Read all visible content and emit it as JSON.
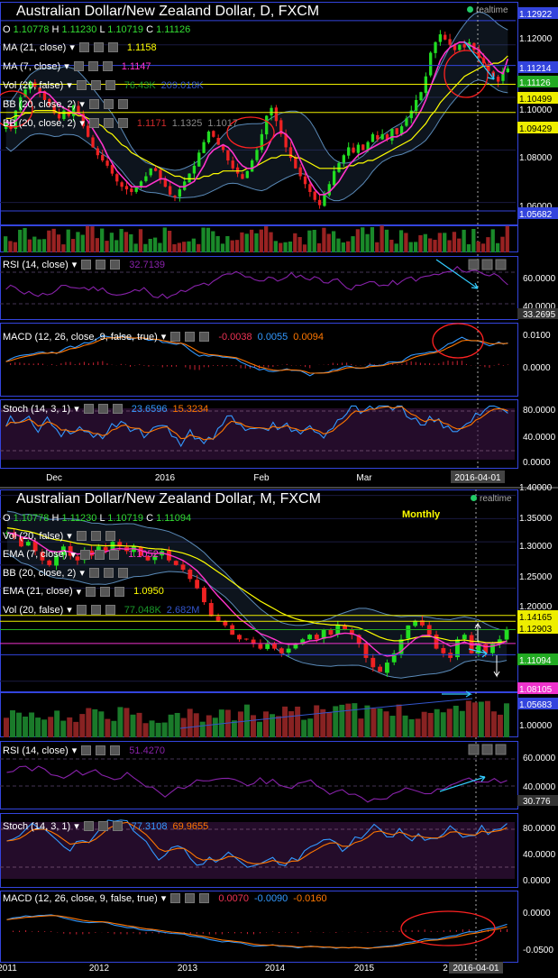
{
  "colors": {
    "background": "#000000",
    "grid": "#1a1a40",
    "frame": "#3344dd",
    "candle_up": "#22dd22",
    "candle_down": "#ee2222",
    "ma21": "#ffff00",
    "ma7": "#ff33cc",
    "bollinger": "#5a8ab8",
    "rsi": "#8822aa",
    "macd_line": "#3399ff",
    "signal_line": "#ff7700",
    "stoch_k": "#3399ff",
    "stoch_d": "#ff7700",
    "annotation": "#ff2222",
    "arrow": "#33ccff"
  },
  "daily": {
    "title": "Australian Dollar/New Zealand Dollar, D, FXCM",
    "realtime": "realtime",
    "ohlc": {
      "o_label": "O",
      "o": "1.10778",
      "h_label": "H",
      "h": "1.11230",
      "l_label": "L",
      "l": "1.10719",
      "c_label": "C",
      "c": "1.11126"
    },
    "indicators": [
      {
        "label": "MA (21, close)",
        "values": [
          "1.1158"
        ],
        "colors": [
          "#ffff00"
        ]
      },
      {
        "label": "MA (7, close)",
        "values": [
          "1.1147"
        ],
        "colors": [
          "#ff33cc"
        ]
      },
      {
        "label": "Vol (20, false)",
        "values": [
          "76.43K",
          "209.018K"
        ],
        "colors": [
          "#1a9a2a",
          "#3355cc"
        ]
      },
      {
        "label": "BB (20, close, 2)",
        "values": [],
        "colors": []
      },
      {
        "label": "BB (20, close, 2)",
        "values": [
          "1.1171",
          "1.1325",
          "1.1017"
        ],
        "colors": [
          "#cc2a2a",
          "#888888",
          "#888888"
        ]
      }
    ],
    "price_labels": [
      {
        "text": "1.12922",
        "bg": "#3344dd",
        "fg": "#ffffff"
      },
      {
        "text": "1.12000",
        "bg": "",
        "fg": "#ffffff"
      },
      {
        "text": "1.11214",
        "bg": "#3344dd",
        "fg": "#ffffff"
      },
      {
        "text": "1.11126",
        "bg": "#22aa22",
        "fg": "#ffffff"
      },
      {
        "text": "1.10499",
        "bg": "#eeee00",
        "fg": "#000000"
      },
      {
        "text": "1.10000",
        "bg": "",
        "fg": "#ffffff"
      },
      {
        "text": "1.09429",
        "bg": "#eeee00",
        "fg": "#000000"
      },
      {
        "text": "1.08000",
        "bg": "",
        "fg": "#ffffff"
      },
      {
        "text": "1.06000",
        "bg": "",
        "fg": "#ffffff"
      },
      {
        "text": "1.05682",
        "bg": "#3344dd",
        "fg": "#ffffff"
      }
    ],
    "rsi": {
      "label": "RSI (14, close)",
      "value": "32.7139",
      "value_color": "#8822aa",
      "axis": [
        "60.0000",
        "40.0000",
        "33.2695"
      ]
    },
    "macd": {
      "label": "MACD (12, 26, close, 9, false, true)",
      "values": [
        "-0.0038",
        "0.0055",
        "0.0094"
      ],
      "colors": [
        "#ee3355",
        "#3399ff",
        "#ff7700"
      ],
      "axis": [
        "0.0100",
        "0.0000"
      ]
    },
    "stoch": {
      "label": "Stoch (14, 3, 1)",
      "values": [
        "23.6596",
        "15.3234"
      ],
      "colors": [
        "#3399ff",
        "#ff7700"
      ],
      "axis": [
        "80.0000",
        "40.0000",
        "0.0000"
      ]
    },
    "x_labels": [
      "Dec",
      "2016",
      "Feb",
      "Mar"
    ],
    "date_label": "2016-04-01"
  },
  "monthly": {
    "title": "Australian Dollar/New Zealand Dollar, M, FXCM",
    "realtime": "realtime",
    "annotation": "Monthly",
    "ohlc": {
      "o_label": "O",
      "o": "1.10778",
      "h_label": "H",
      "h": "1.11230",
      "l_label": "L",
      "l": "1.10719",
      "c_label": "C",
      "c": "1.11094"
    },
    "indicators": [
      {
        "label": "Vol (20, false)",
        "values": [],
        "colors": []
      },
      {
        "label": "EMA (7, close)",
        "values": [
          "1.1052"
        ],
        "colors": [
          "#ff33cc"
        ]
      },
      {
        "label": "BB (20, close, 2)",
        "values": [],
        "colors": []
      },
      {
        "label": "EMA (21, close)",
        "values": [
          "1.0950"
        ],
        "colors": [
          "#ffff00"
        ]
      },
      {
        "label": "Vol (20, false)",
        "values": [
          "77.048K",
          "2.682M"
        ],
        "colors": [
          "#1a9a2a",
          "#3355cc"
        ]
      }
    ],
    "price_labels": [
      {
        "text": "1.40000",
        "bg": "",
        "fg": "#ffffff"
      },
      {
        "text": "1.35000",
        "bg": "",
        "fg": "#ffffff"
      },
      {
        "text": "1.30000",
        "bg": "",
        "fg": "#ffffff"
      },
      {
        "text": "1.25000",
        "bg": "",
        "fg": "#ffffff"
      },
      {
        "text": "1.20000",
        "bg": "",
        "fg": "#ffffff"
      },
      {
        "text": "1.14165",
        "bg": "#eeee00",
        "fg": "#000000"
      },
      {
        "text": "1.12903",
        "bg": "#eeee00",
        "fg": "#000000"
      },
      {
        "text": "1.11094",
        "bg": "#22aa22",
        "fg": "#ffffff"
      },
      {
        "text": "1.08105",
        "bg": "#ee33cc",
        "fg": "#ffffff"
      },
      {
        "text": "1.05683",
        "bg": "#3344dd",
        "fg": "#ffffff"
      },
      {
        "text": "1.00000",
        "bg": "",
        "fg": "#ffffff"
      }
    ],
    "rsi": {
      "label": "RSI (14, close)",
      "value": "51.4270",
      "value_color": "#8822aa",
      "axis": [
        "60.0000",
        "40.0000",
        "30.776"
      ]
    },
    "stoch": {
      "label": "Stoch (14, 3, 1)",
      "values": [
        "77.3108",
        "69.9655"
      ],
      "colors": [
        "#3399ff",
        "#ff7700"
      ],
      "axis": [
        "80.0000",
        "40.0000",
        "0.0000"
      ]
    },
    "macd": {
      "label": "MACD (12, 26, close, 9, false, true)",
      "values": [
        "0.0070",
        "-0.0090",
        "-0.0160"
      ],
      "colors": [
        "#ee3355",
        "#3399ff",
        "#ff7700"
      ],
      "axis": [
        "0.0000",
        "-0.0500"
      ]
    },
    "x_labels": [
      "2011",
      "2012",
      "2013",
      "2014",
      "2015",
      "2"
    ],
    "date_label": "2016-04-01"
  },
  "chart_data": [
    {
      "type": "candlestick",
      "title": "Australian Dollar/New Zealand Dollar, D, FXCM",
      "x_ticks": [
        "Dec",
        "2016",
        "Feb",
        "Mar"
      ],
      "last_date": "2016-04-01",
      "ylim": [
        1.052,
        1.135
      ],
      "y_ticks": [
        1.06,
        1.08,
        1.1,
        1.12
      ],
      "levels": [
        1.12922,
        1.11214,
        1.10499,
        1.09429,
        1.05682
      ],
      "close_series": [
        1.09,
        1.088,
        1.095,
        1.1,
        1.103,
        1.106,
        1.104,
        1.102,
        1.099,
        1.097,
        1.094,
        1.092,
        1.095,
        1.093,
        1.097,
        1.094,
        1.089,
        1.085,
        1.081,
        1.078,
        1.076,
        1.074,
        1.071,
        1.068,
        1.066,
        1.065,
        1.064,
        1.066,
        1.068,
        1.07,
        1.073,
        1.072,
        1.069,
        1.066,
        1.063,
        1.062,
        1.065,
        1.068,
        1.071,
        1.074,
        1.079,
        1.083,
        1.087,
        1.085,
        1.082,
        1.08,
        1.076,
        1.073,
        1.071,
        1.069,
        1.072,
        1.076,
        1.08,
        1.086,
        1.093,
        1.096,
        1.091,
        1.086,
        1.081,
        1.077,
        1.073,
        1.07,
        1.067,
        1.064,
        1.061,
        1.059,
        1.063,
        1.067,
        1.072,
        1.075,
        1.078,
        1.081,
        1.079,
        1.082,
        1.08,
        1.083,
        1.086,
        1.084,
        1.086,
        1.084,
        1.088,
        1.086,
        1.089,
        1.092,
        1.095,
        1.099,
        1.102,
        1.108,
        1.117,
        1.121,
        1.124,
        1.122,
        1.12,
        1.118,
        1.12,
        1.119,
        1.121,
        1.118,
        1.115,
        1.113,
        1.11,
        1.108,
        1.106,
        1.11,
        1.111
      ],
      "ma21": [
        1.092,
        1.092,
        1.093,
        1.093,
        1.094,
        1.094,
        1.095,
        1.095,
        1.095,
        1.095,
        1.095,
        1.094,
        1.094,
        1.094,
        1.094,
        1.093,
        1.093,
        1.092,
        1.091,
        1.09,
        1.089,
        1.087,
        1.086,
        1.084,
        1.082,
        1.081,
        1.079,
        1.078,
        1.077,
        1.076,
        1.075,
        1.074,
        1.073,
        1.072,
        1.071,
        1.07,
        1.07,
        1.069,
        1.069,
        1.069,
        1.069,
        1.07,
        1.07,
        1.071,
        1.071,
        1.072,
        1.072,
        1.072,
        1.072,
        1.072,
        1.073,
        1.073,
        1.074,
        1.075,
        1.076,
        1.077,
        1.077,
        1.078,
        1.078,
        1.078,
        1.077,
        1.077,
        1.076,
        1.075,
        1.074,
        1.073,
        1.073,
        1.073,
        1.073,
        1.073,
        1.073,
        1.074,
        1.074,
        1.075,
        1.075,
        1.076,
        1.076,
        1.077,
        1.078,
        1.079,
        1.08,
        1.081,
        1.082,
        1.083,
        1.084,
        1.086,
        1.088,
        1.09,
        1.093,
        1.095,
        1.098,
        1.1,
        1.102,
        1.104,
        1.106,
        1.108,
        1.109,
        1.11,
        1.111,
        1.112,
        1.112,
        1.113,
        1.113,
        1.114,
        1.1158
      ],
      "ma7": [
        1.091,
        1.09,
        1.091,
        1.093,
        1.096,
        1.099,
        1.101,
        1.102,
        1.102,
        1.101,
        1.099,
        1.097,
        1.096,
        1.095,
        1.094,
        1.094,
        1.093,
        1.091,
        1.088,
        1.085,
        1.082,
        1.078,
        1.075,
        1.072,
        1.07,
        1.068,
        1.066,
        1.066,
        1.066,
        1.066,
        1.067,
        1.068,
        1.069,
        1.069,
        1.068,
        1.067,
        1.066,
        1.066,
        1.067,
        1.068,
        1.071,
        1.074,
        1.078,
        1.08,
        1.081,
        1.082,
        1.081,
        1.079,
        1.076,
        1.074,
        1.073,
        1.073,
        1.074,
        1.077,
        1.08,
        1.084,
        1.086,
        1.087,
        1.086,
        1.084,
        1.08,
        1.076,
        1.072,
        1.068,
        1.065,
        1.063,
        1.063,
        1.064,
        1.066,
        1.068,
        1.071,
        1.074,
        1.076,
        1.078,
        1.079,
        1.08,
        1.081,
        1.082,
        1.083,
        1.084,
        1.085,
        1.085,
        1.086,
        1.087,
        1.089,
        1.092,
        1.095,
        1.099,
        1.104,
        1.109,
        1.114,
        1.117,
        1.119,
        1.12,
        1.121,
        1.121,
        1.12,
        1.119,
        1.118,
        1.116,
        1.114,
        1.112,
        1.11,
        1.109,
        1.1147
      ],
      "rsi_last": 32.7139,
      "macd_last": [
        -0.0038,
        0.0055,
        0.0094
      ],
      "stoch_last": [
        23.6596,
        15.3234
      ]
    },
    {
      "type": "candlestick",
      "title": "Australian Dollar/New Zealand Dollar, M, FXCM",
      "x_ticks": [
        "2011",
        "2012",
        "2013",
        "2014",
        "2015"
      ],
      "last_date": "2016-04-01",
      "ylim": [
        0.98,
        1.405
      ],
      "y_ticks": [
        1.0,
        1.2,
        1.25,
        1.3,
        1.35,
        1.4
      ],
      "levels": [
        1.14165,
        1.12903,
        1.11094,
        1.08105,
        1.05683
      ],
      "close_series": [
        1.32,
        1.31,
        1.29,
        1.3,
        1.28,
        1.26,
        1.25,
        1.27,
        1.29,
        1.27,
        1.26,
        1.28,
        1.27,
        1.29,
        1.28,
        1.3,
        1.29,
        1.28,
        1.29,
        1.27,
        1.26,
        1.27,
        1.28,
        1.26,
        1.25,
        1.24,
        1.22,
        1.2,
        1.17,
        1.14,
        1.13,
        1.12,
        1.1,
        1.09,
        1.09,
        1.08,
        1.07,
        1.08,
        1.07,
        1.06,
        1.07,
        1.08,
        1.09,
        1.1,
        1.09,
        1.11,
        1.1,
        1.12,
        1.11,
        1.1,
        1.08,
        1.05,
        1.03,
        1.02,
        1.04,
        1.06,
        1.09,
        1.12,
        1.13,
        1.12,
        1.1,
        1.07,
        1.06,
        1.05,
        1.09,
        1.1,
        1.06,
        1.08,
        1.06,
        1.08,
        1.09,
        1.11
      ],
      "rsi_last": 51.427,
      "macd_last": [
        0.007,
        -0.009,
        -0.016
      ],
      "stoch_last": [
        77.3108,
        69.9655
      ]
    }
  ]
}
